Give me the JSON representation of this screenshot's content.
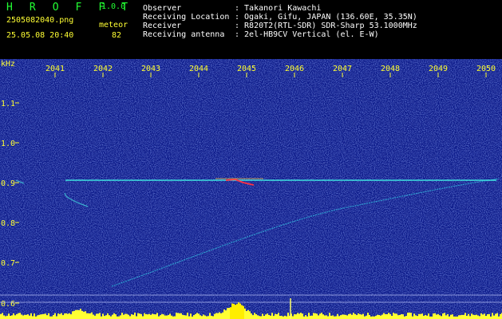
{
  "header": {
    "app_name": "H R O F F T",
    "version": "1.0.0",
    "filename": "2505082040.png",
    "datetime": "25.05.08 20:40",
    "meteor_label": "meteor",
    "meteor_count": "82",
    "info_labels": [
      "Observer",
      "Receiving Location",
      "Receiver",
      "Receiving antenna"
    ],
    "info_values": [
      ": Takanori Kawachi",
      ": Ogaki, Gifu, JAPAN (136.60E, 35.35N)",
      ": R820T2(RTL-SDR) SDR-Sharp 53.1000MHz",
      ": 2el-HB9CV Vertical (el. E-W)"
    ]
  },
  "spectrogram": {
    "unit_label": "kHz",
    "time_ticks": [
      "2041",
      "2042",
      "2043",
      "2044",
      "2045",
      "2046",
      "2047",
      "2048",
      "2049",
      "2050"
    ],
    "freq_ticks": [
      "1.1",
      "1.0",
      "0.9",
      "0.8",
      "0.7",
      "0.6"
    ],
    "background_color": "#101c8c",
    "carrier_color": "#3fe0e0",
    "axis_color": "#ffff33"
  }
}
